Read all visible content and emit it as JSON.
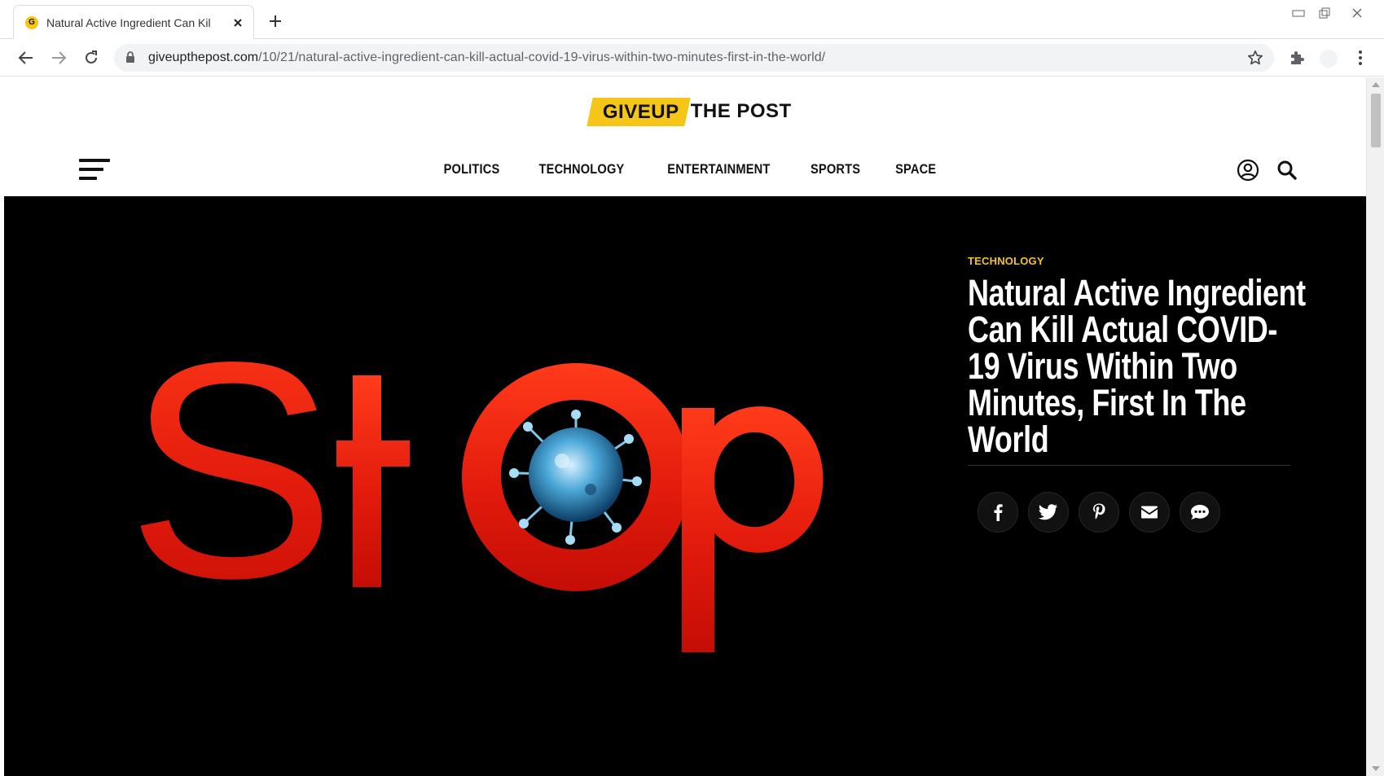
{
  "browser": {
    "tab_title": "Natural Active Ingredient Can Kil",
    "favicon_letter": "G",
    "url_domain": "giveupthepost.com",
    "url_path": "/10/21/natural-active-ingredient-can-kill-actual-covid-19-virus-within-two-minutes-first-in-the-world/"
  },
  "site": {
    "logo_highlight": "GIVEUP",
    "logo_rest": "THE POST",
    "accent_color": "#f5c518"
  },
  "nav": {
    "items": [
      "POLITICS",
      "TECHNOLOGY",
      "ENTERTAINMENT",
      "SPORTS",
      "SPACE"
    ]
  },
  "article": {
    "category": "TECHNOLOGY",
    "title": "Natural Active Ingredient Can Kill Actual COVID-19 Virus Within Two Minutes, First In The World",
    "hero_text": "StOp",
    "share_icons": [
      "facebook-icon",
      "twitter-icon",
      "pinterest-icon",
      "email-icon",
      "comment-icon"
    ]
  }
}
